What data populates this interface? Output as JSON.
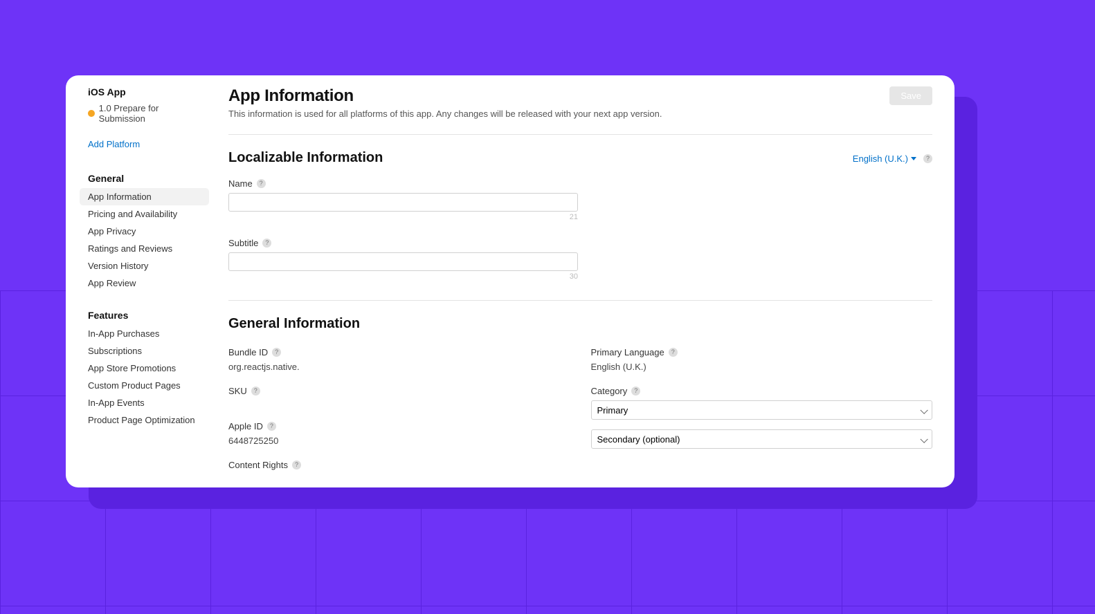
{
  "sidebar": {
    "app_name": "iOS App",
    "status_text": "1.0 Prepare for Submission",
    "add_platform": "Add Platform",
    "groups": [
      {
        "title": "General",
        "items": [
          {
            "label": "App Information",
            "active": true
          },
          {
            "label": "Pricing and Availability"
          },
          {
            "label": "App Privacy"
          },
          {
            "label": "Ratings and Reviews"
          },
          {
            "label": "Version History"
          },
          {
            "label": "App Review"
          }
        ]
      },
      {
        "title": "Features",
        "items": [
          {
            "label": "In-App Purchases"
          },
          {
            "label": "Subscriptions"
          },
          {
            "label": "App Store Promotions"
          },
          {
            "label": "Custom Product Pages"
          },
          {
            "label": "In-App Events"
          },
          {
            "label": "Product Page Optimization"
          }
        ]
      }
    ]
  },
  "header": {
    "title": "App Information",
    "description": "This information is used for all platforms of this app. Any changes will be released with your next app version.",
    "save_label": "Save"
  },
  "localizable": {
    "section_title": "Localizable Information",
    "language_selector": "English (U.K.)",
    "name_label": "Name",
    "name_value": "",
    "name_count": "21",
    "subtitle_label": "Subtitle",
    "subtitle_value": "",
    "subtitle_count": "30"
  },
  "general_info": {
    "section_title": "General Information",
    "bundle_id_label": "Bundle ID",
    "bundle_id_value": "org.reactjs.native.",
    "sku_label": "SKU",
    "sku_value": "",
    "apple_id_label": "Apple ID",
    "apple_id_value": "6448725250",
    "content_rights_label": "Content Rights",
    "primary_language_label": "Primary Language",
    "primary_language_value": "English (U.K.)",
    "category_label": "Category",
    "category_primary": "Primary",
    "category_secondary": "Secondary (optional)"
  }
}
